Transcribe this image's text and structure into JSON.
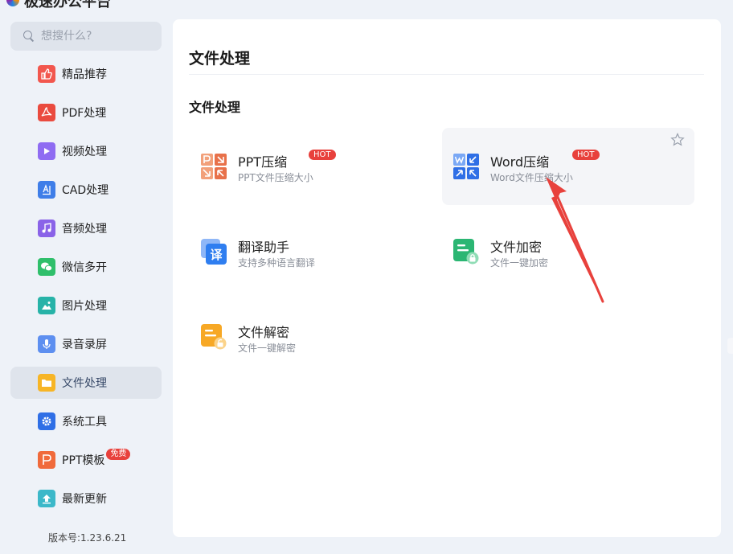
{
  "app": {
    "title": "极速办公平台"
  },
  "sidebar": {
    "search_placeholder": "想搜什么?",
    "items": [
      {
        "label": "精品推荐",
        "icon": "thumbs-up-icon",
        "color": "#f2574e"
      },
      {
        "label": "PDF处理",
        "icon": "pdf-icon",
        "color": "#ea4b3f"
      },
      {
        "label": "视频处理",
        "icon": "video-play-icon",
        "color": "#8f6cf2"
      },
      {
        "label": "CAD处理",
        "icon": "cad-icon",
        "color": "#3f7ee8"
      },
      {
        "label": "音频处理",
        "icon": "music-note-icon",
        "color": "#8a63e8"
      },
      {
        "label": "微信多开",
        "icon": "wechat-icon",
        "color": "#2fbf6b"
      },
      {
        "label": "图片处理",
        "icon": "image-icon",
        "color": "#27b3a8"
      },
      {
        "label": "录音录屏",
        "icon": "microphone-icon",
        "color": "#5d8ff0"
      },
      {
        "label": "文件处理",
        "icon": "folder-icon",
        "color": "#f7b526",
        "active": true
      },
      {
        "label": "系统工具",
        "icon": "gear-icon",
        "color": "#2f6fe6"
      },
      {
        "label": "PPT模板",
        "icon": "ppt-icon",
        "color": "#f06a3b",
        "badge": "免费"
      },
      {
        "label": "最新更新",
        "icon": "upload-icon",
        "color": "#3cb8c9"
      }
    ],
    "version": "版本号:1.23.6.21"
  },
  "main": {
    "title": "文件处理",
    "section_title": "文件处理",
    "tools": [
      {
        "name": "PPT压缩",
        "desc": "PPT文件压缩大小",
        "badge": "HOT",
        "icon": "ppt-compress-icon"
      },
      {
        "name": "Word压缩",
        "desc": "Word文件压缩大小",
        "badge": "HOT",
        "icon": "word-compress-icon",
        "hovered": true
      },
      {
        "name": "翻译助手",
        "desc": "支持多种语言翻译",
        "icon": "translate-icon"
      },
      {
        "name": "文件加密",
        "desc": "文件一键加密",
        "icon": "file-encrypt-icon"
      },
      {
        "name": "文件解密",
        "desc": "文件一键解密",
        "icon": "file-decrypt-icon"
      }
    ]
  },
  "colors": {
    "hot_badge": "#e8413c",
    "annotation_arrow": "#e8413c",
    "active_bg": "#dfe4ec"
  }
}
